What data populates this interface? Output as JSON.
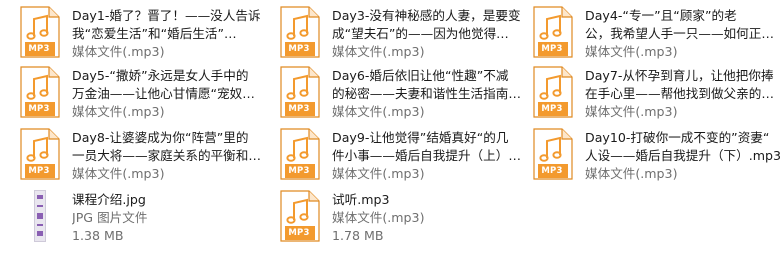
{
  "files": [
    {
      "kind": "mp3",
      "line1": "Day1-婚了？晋了！——没人告诉",
      "line2": "我“恋爱生活”和“婚后生活”…",
      "line3": "媒体文件(.mp3)"
    },
    {
      "kind": "mp3",
      "line1": "Day3-没有神秘感的人妻，是要变",
      "line2": "成“望夫石”的——因为他觉得…",
      "line3": "媒体文件(.mp3)"
    },
    {
      "kind": "mp3",
      "line1": "Day4-“专一”且“顾家”的老",
      "line2": "公，我希望人手一只——如何正…",
      "line3": "媒体文件(.mp3)"
    },
    {
      "kind": "mp3",
      "line1": "Day5-“撒娇”永远是女人手中的",
      "line2": "万金油——让他心甘情愿“宠奴…",
      "line3": "媒体文件(.mp3)"
    },
    {
      "kind": "mp3",
      "line1": "Day6-婚后依旧让他“性趣”不减",
      "line2": "的秘密——夫妻和谐性生活指南…",
      "line3": "媒体文件(.mp3)"
    },
    {
      "kind": "mp3",
      "line1": "Day7-从怀孕到育儿，让他把你捧",
      "line2": "在手心里——帮他找到做父亲的…",
      "line3": "媒体文件(.mp3)"
    },
    {
      "kind": "mp3",
      "line1": "Day8-让婆婆成为你“阵营”里的",
      "line2": "一员大将——家庭关系的平衡和…",
      "line3": "媒体文件(.mp3)"
    },
    {
      "kind": "mp3",
      "line1": "Day9-让他觉得”结婚真好“的几",
      "line2": "件小事——婚后自我提升（上）…",
      "line3": "媒体文件(.mp3)"
    },
    {
      "kind": "mp3",
      "line1": "Day10-打破你一成不变的”资妻“",
      "line2": "人设——婚后自我提升（下）.mp3",
      "line3": "媒体文件(.mp3)"
    },
    {
      "kind": "jpg",
      "line1": "课程介绍.jpg",
      "line2": "JPG 图片文件",
      "line3": "1.38 MB"
    },
    {
      "kind": "mp3",
      "line1": "试听.mp3",
      "line2": "媒体文件(.mp3)",
      "line3": "1.78 MB"
    }
  ],
  "icon": {
    "mp3_label": "MP3",
    "mp3_name": "music-note-file-icon",
    "jpg_name": "image-file-thumbnail-icon"
  },
  "colors": {
    "mp3_accent": "#f39a2e",
    "mp3_border": "#e08a22",
    "jpg_accent": "#8a5fb3"
  }
}
